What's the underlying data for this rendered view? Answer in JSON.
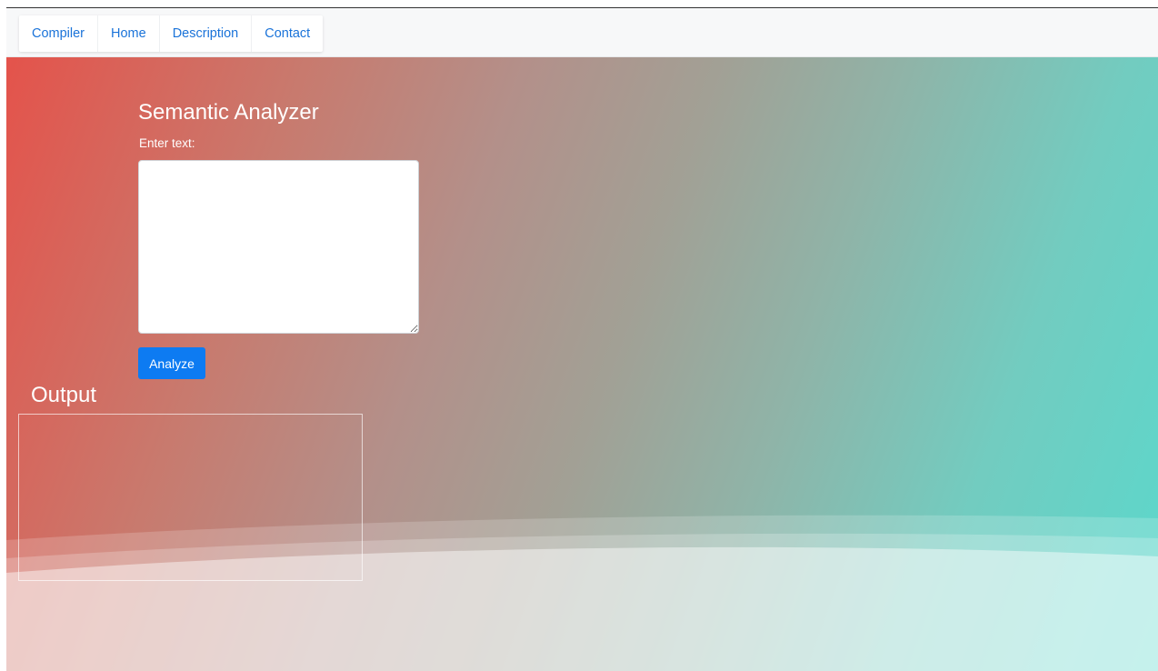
{
  "nav": {
    "items": [
      {
        "label": "Compiler"
      },
      {
        "label": "Home"
      },
      {
        "label": "Description"
      },
      {
        "label": "Contact"
      }
    ]
  },
  "main": {
    "title": "Semantic Analyzer",
    "input_label": "Enter text:",
    "input_value": "",
    "analyze_label": "Analyze",
    "output_title": "Output",
    "output_value": ""
  },
  "colors": {
    "accent": "#0d7bf2",
    "link": "#1a73d9",
    "gradient_start": "#e4534b",
    "gradient_end": "#5ad8cc"
  }
}
